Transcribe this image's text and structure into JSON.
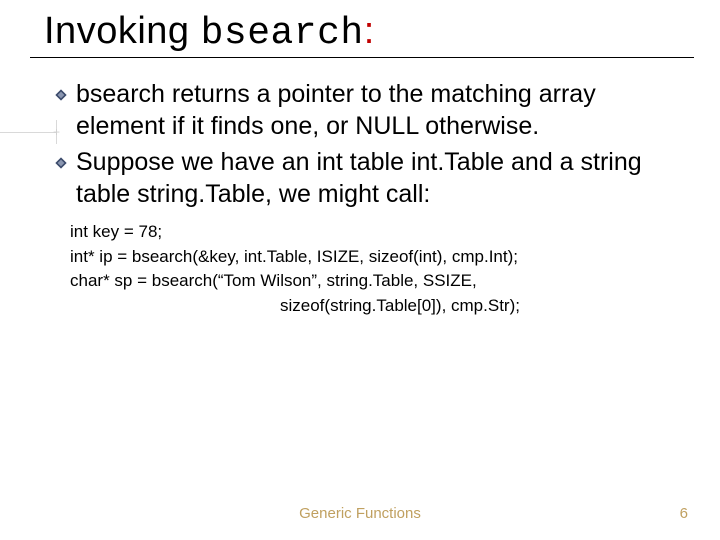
{
  "title": {
    "pre": "Invoking ",
    "code": "bsearch",
    "colon": ":"
  },
  "bullets": [
    {
      "text": "bsearch returns a pointer to the matching array element if it finds one, or NULL otherwise."
    },
    {
      "text": "Suppose we have an int table int.Table and a string table string.Table, we might call:"
    }
  ],
  "code": {
    "l1": "int key = 78;",
    "l2": "int* ip = bsearch(&key, int.Table, ISIZE, sizeof(int), cmp.Int);",
    "l3": "char* sp = bsearch(“Tom Wilson”, string.Table, SSIZE,",
    "l4": "sizeof(string.Table[0]), cmp.Str);"
  },
  "footer": {
    "label": "Generic Functions",
    "page": "6"
  }
}
